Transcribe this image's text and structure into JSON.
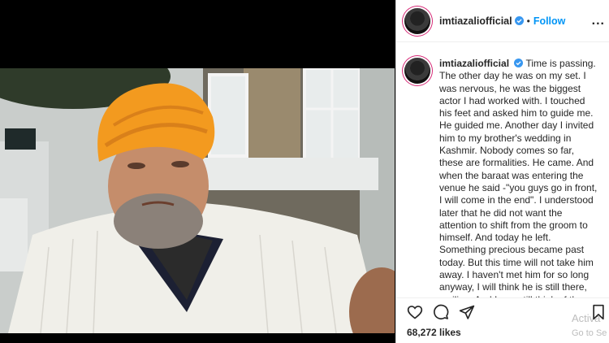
{
  "post": {
    "username": "imtiazaliofficial",
    "follow_label": "Follow",
    "separator": "•",
    "more_icon": "...",
    "caption": "Time is passing. The other day he was on my set. I was nervous, he was the biggest actor I had worked with. I touched his feet and asked him to guide me. He guided me. Another day I invited him to my brother's wedding in Kashmir. Nobody comes so far, these are formalities. He came. And when the baraat was entering the venue he said -\"you guys go in front, I will come in the end\". I understood later that he did not want the attention to shift from the groom to himself. And today he left. Something precious became past today. But this time will not take him away. I haven't met him for so long anyway, I will think he is still there, smiling. And I can still think of the little time I could spend with him",
    "likes": "68,272 likes"
  },
  "overlay": {
    "line1": "Activa",
    "line2": "Go to Se"
  },
  "colors": {
    "link_blue": "#0095f6",
    "text": "#262626",
    "verified": "#3897f0",
    "turban": "#f39a1f"
  },
  "icons": [
    "verified-badge-icon",
    "more-options-icon",
    "heart-icon",
    "comment-icon",
    "share-icon",
    "bookmark-icon"
  ]
}
